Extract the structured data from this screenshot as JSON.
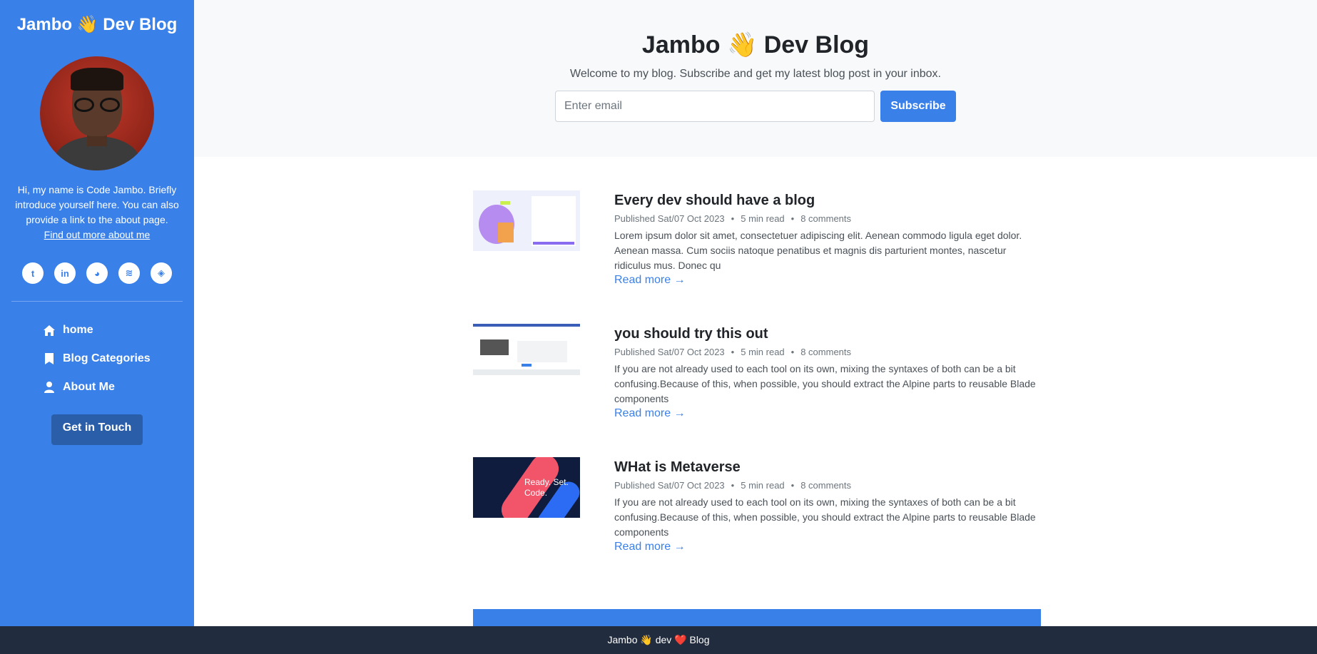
{
  "sidebar": {
    "brand": "Jambo 👋 Dev Blog",
    "intro": "Hi, my name is Code Jambo. Briefly introduce yourself here. You can also provide a link to the about page.",
    "about_link": "Find out more about me",
    "socials": [
      {
        "icon": "twitter-icon",
        "glyph": "t"
      },
      {
        "icon": "linkedin-icon",
        "glyph": "in"
      },
      {
        "icon": "github-icon",
        "glyph": "◕"
      },
      {
        "icon": "stackoverflow-icon",
        "glyph": "≋"
      },
      {
        "icon": "codepen-icon",
        "glyph": "◈"
      }
    ],
    "nav": [
      {
        "label": "home",
        "icon": "home-icon"
      },
      {
        "label": "Blog Categories",
        "icon": "bookmark-icon"
      },
      {
        "label": "About Me",
        "icon": "user-icon"
      }
    ],
    "cta_label": "Get in Touch"
  },
  "header": {
    "title": "Jambo 👋 Dev Blog",
    "subtitle": "Welcome to my blog. Subscribe and get my latest blog post in your inbox.",
    "email_placeholder": "Enter email",
    "subscribe_label": "Subscribe"
  },
  "posts": [
    {
      "title": "Every dev should have a blog",
      "published": "Published Sat/07 Oct 2023",
      "read_time": "5 min read",
      "comments": "8 comments",
      "excerpt": "Lorem ipsum dolor sit amet, consectetuer adipiscing elit. Aenean commodo ligula eget dolor. Aenean massa. Cum sociis natoque penatibus et magnis dis parturient montes, nascetur ridiculus mus. Donec qu",
      "read_more": "Read more →"
    },
    {
      "title": "you should try this out",
      "published": "Published Sat/07 Oct 2023",
      "read_time": "5 min read",
      "comments": "8 comments",
      "excerpt": "If you are not already used to each tool on its own, mixing the syntaxes of both can be a bit confusing.Because of this, when possible, you should extract the Alpine parts to reusable Blade components",
      "read_more": "Read more →"
    },
    {
      "title": "WHat is Metaverse",
      "published": "Published Sat/07 Oct 2023",
      "read_time": "5 min read",
      "comments": "8 comments",
      "excerpt": "If you are not already used to each tool on its own, mixing the syntaxes of both can be a bit confusing.Because of this, when possible, you should extract the Alpine parts to reusable Blade components",
      "read_more": "Read more →",
      "thumb_text": "Ready. Set. Code."
    }
  ],
  "footer": {
    "text": "Jambo 👋 dev ❤️ Blog"
  },
  "colors": {
    "accent": "#3a80e9",
    "cta": "#2b5ea8",
    "footer_bg": "#212c3e"
  }
}
